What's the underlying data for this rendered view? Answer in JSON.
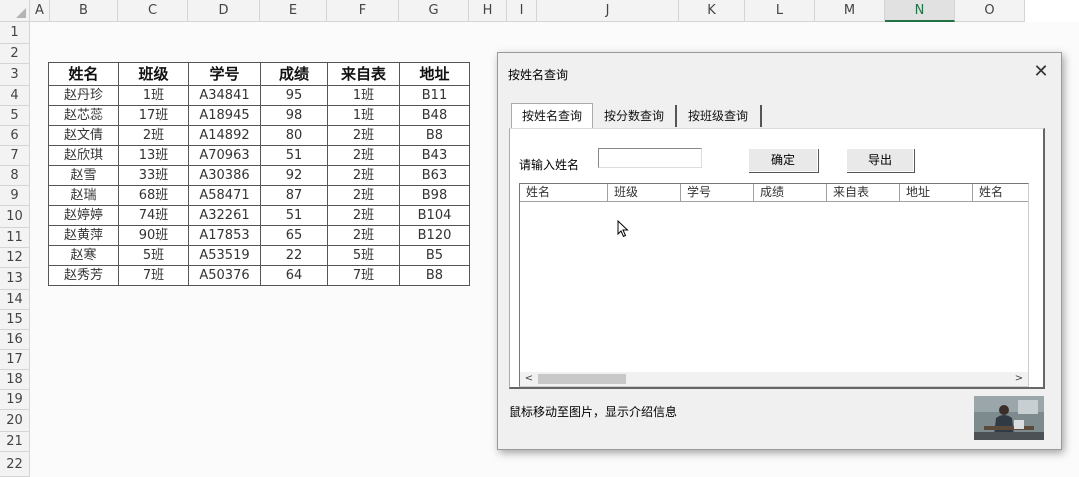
{
  "sheet": {
    "columns": [
      "A",
      "B",
      "C",
      "D",
      "E",
      "F",
      "G",
      "H",
      "I",
      "J",
      "K",
      "L",
      "M",
      "N",
      "O"
    ],
    "selected_column": "N",
    "rows": [
      "1",
      "2",
      "3",
      "4",
      "5",
      "6",
      "7",
      "8",
      "9",
      "10",
      "11",
      "12",
      "13",
      "14",
      "15",
      "16",
      "17",
      "18",
      "19",
      "20",
      "21",
      "22"
    ]
  },
  "table": {
    "headers": [
      "姓名",
      "班级",
      "学号",
      "成绩",
      "来自表",
      "地址"
    ],
    "rows": [
      [
        "赵丹珍",
        "1班",
        "A34841",
        "95",
        "1班",
        "B11"
      ],
      [
        "赵芯蕊",
        "17班",
        "A18945",
        "98",
        "1班",
        "B48"
      ],
      [
        "赵文倩",
        "2班",
        "A14892",
        "80",
        "2班",
        "B8"
      ],
      [
        "赵欣琪",
        "13班",
        "A70963",
        "51",
        "2班",
        "B43"
      ],
      [
        "赵雪",
        "33班",
        "A30386",
        "92",
        "2班",
        "B63"
      ],
      [
        "赵瑞",
        "68班",
        "A58471",
        "87",
        "2班",
        "B98"
      ],
      [
        "赵婷婷",
        "74班",
        "A32261",
        "51",
        "2班",
        "B104"
      ],
      [
        "赵黄萍",
        "90班",
        "A17853",
        "65",
        "2班",
        "B120"
      ],
      [
        "赵寒",
        "5班",
        "A53519",
        "22",
        "5班",
        "B5"
      ],
      [
        "赵秀芳",
        "7班",
        "A50376",
        "64",
        "7班",
        "B8"
      ]
    ]
  },
  "dialog": {
    "title": "按姓名查询",
    "close": "✕",
    "tabs": [
      "按姓名查询",
      "按分数查询",
      "按班级查询"
    ],
    "active_tab": 0,
    "name_label": "请输入姓名",
    "name_value": "",
    "ok_label": "确定",
    "export_label": "导出",
    "list_columns": [
      "姓名",
      "班级",
      "学号",
      "成绩",
      "来自表",
      "地址",
      "姓名"
    ],
    "scroll_left": "<",
    "scroll_right": ">",
    "status_text": "鼠标移动至图片，显示介绍信息"
  },
  "icons": {
    "close": "close-icon",
    "cursor": "mouse-pointer-icon",
    "thumbnail": "photo-thumbnail"
  }
}
